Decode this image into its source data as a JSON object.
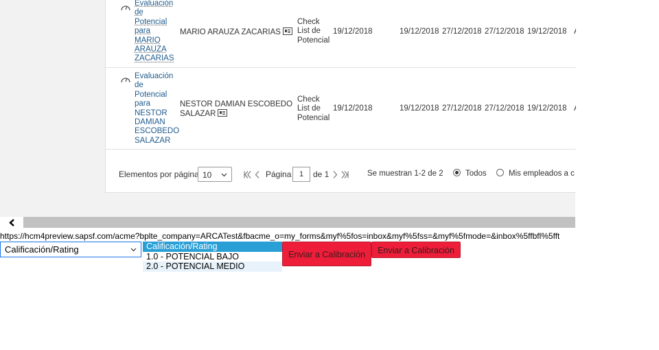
{
  "table": {
    "rows": [
      {
        "form_lines": [
          "Evaluación",
          "de",
          "Potencial",
          "para",
          "MARIO",
          "ARAUZA",
          "ZACARIAS"
        ],
        "employee": "MARIO ARAUZA ZACARIAS",
        "step_lines": [
          "Check",
          "List de",
          "Potencial"
        ],
        "date1": "19/12/2018",
        "date2": "19/12/2018",
        "date3": "27/12/2018",
        "date4": "27/12/2018",
        "date5": "19/12/2018",
        "trailing": "A"
      },
      {
        "form_lines": [
          "Evaluación",
          "de",
          "Potencial",
          "para",
          "NESTOR",
          "DAMIAN",
          "ESCOBEDO",
          "SALAZAR"
        ],
        "employee_lines": [
          "NESTOR DAMIAN ESCOBEDO",
          "SALAZAR"
        ],
        "step_lines": [
          "Check",
          "List de",
          "Potencial"
        ],
        "date1": "19/12/2018",
        "date2": "19/12/2018",
        "date3": "27/12/2018",
        "date4": "27/12/2018",
        "date5": "19/12/2018",
        "trailing": "A"
      }
    ]
  },
  "pager": {
    "items_per_page_label": "Elementos por página",
    "items_per_page_value": "10",
    "page_label": "Página",
    "page_value": "1",
    "of_label": "de 1",
    "showing_label": "Se muestran 1-2 de 2",
    "radio_all": "Todos",
    "radio_mine": "Mis empleados a c"
  },
  "url": "https://hcm4preview.sapsf.com/acme?bplte_company=ARCATest&fbacme_o=my_forms&myf%5fos=inbox&myf%5fss=&myf%5fmode=&inbox%5ffbfl%5fft",
  "rating_select": {
    "value": "Calificación/Rating",
    "options": [
      "Calificación/Rating",
      "1.0 - POTENCIAL BAJO",
      "2.0 - POTENCIAL MEDIO"
    ]
  },
  "buttons": {
    "send_calibration_1": "Enviar a Calibración",
    "send_calibration_2": "Enviar a Calibración"
  },
  "colors": {
    "accent_blue": "#2a9fd6",
    "link": "#1f5a8c",
    "button_red": "#ee1d3a"
  }
}
